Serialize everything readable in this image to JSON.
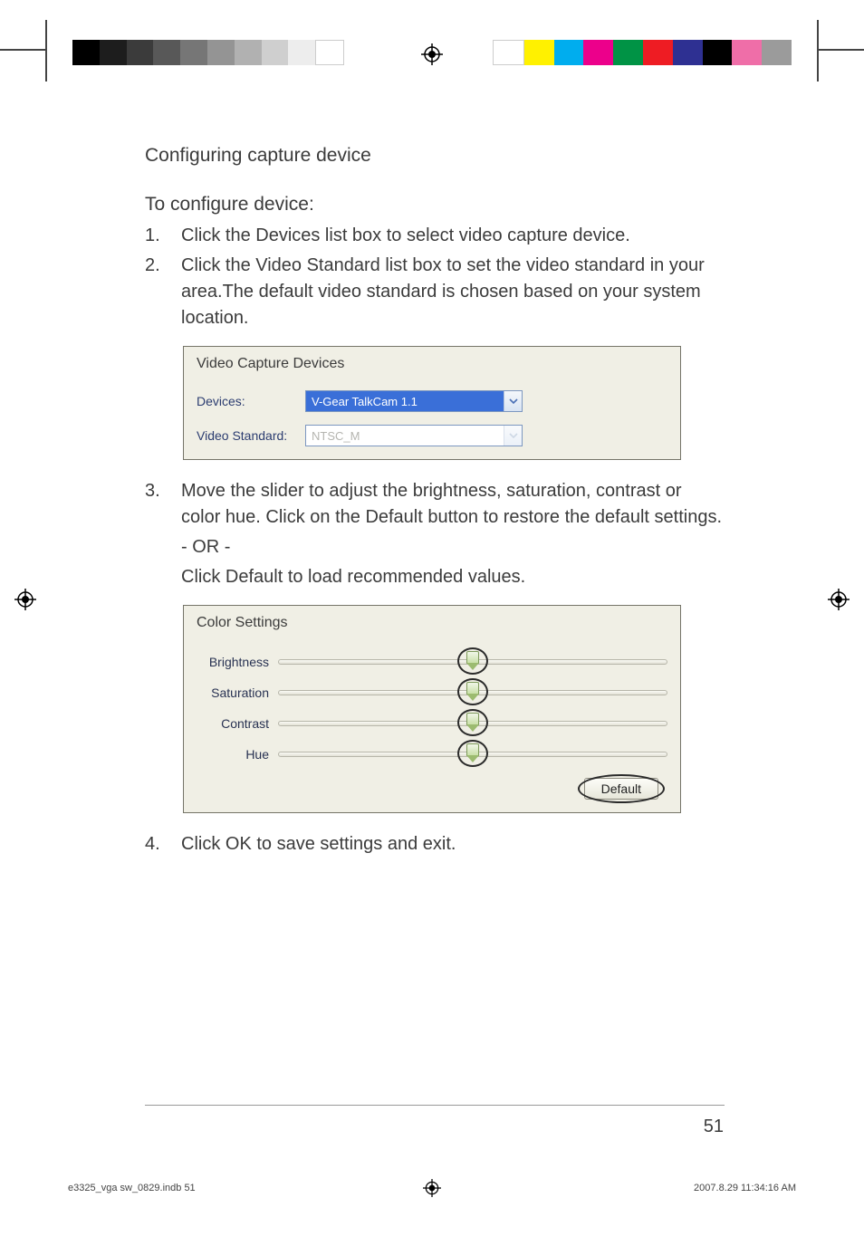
{
  "heading": "Configuring capture device",
  "subheading": "To configure device:",
  "steps": {
    "s1": {
      "num": "1.",
      "text": "Click the Devices list box to select video capture device."
    },
    "s2": {
      "num": "2.",
      "text": "Click the Video Standard list box to set the video standard in your area.The default video standard is chosen based on your system location."
    },
    "s3": {
      "num": "3.",
      "text": "Move the slider to adjust the brightness, saturation, contrast or color hue. Click on the Default button to restore the default settings.",
      "or": "- OR -",
      "alt": "Click Default to load recommended values."
    },
    "s4": {
      "num": "4.",
      "text": "Click OK to save settings and exit."
    }
  },
  "capture_box": {
    "legend": "Video Capture Devices",
    "devices_label": "Devices:",
    "devices_value": "V-Gear TalkCam 1.1",
    "standard_label": "Video Standard:",
    "standard_value": "NTSC_M"
  },
  "color_box": {
    "legend": "Color Settings",
    "brightness": "Brightness",
    "saturation": "Saturation",
    "contrast": "Contrast",
    "hue": "Hue",
    "default_btn": "Default"
  },
  "page_number": "51",
  "footer": {
    "filename": "e3325_vga sw_0829.indb   51",
    "datetime": "2007.8.29   11:34:16 AM"
  },
  "colors": {
    "gray_bar": [
      "#000000",
      "#1d1d1d",
      "#3b3b3b",
      "#585858",
      "#767676",
      "#949494",
      "#b1b1b1",
      "#cfcfcf",
      "#ededed",
      "#ffffff"
    ],
    "color_bar": [
      "#ffffff",
      "#fff100",
      "#00adee",
      "#ec008b",
      "#009345",
      "#ee1c23",
      "#2e3092",
      "#000000",
      "#ef6ea8",
      "#9b9b9b"
    ]
  }
}
